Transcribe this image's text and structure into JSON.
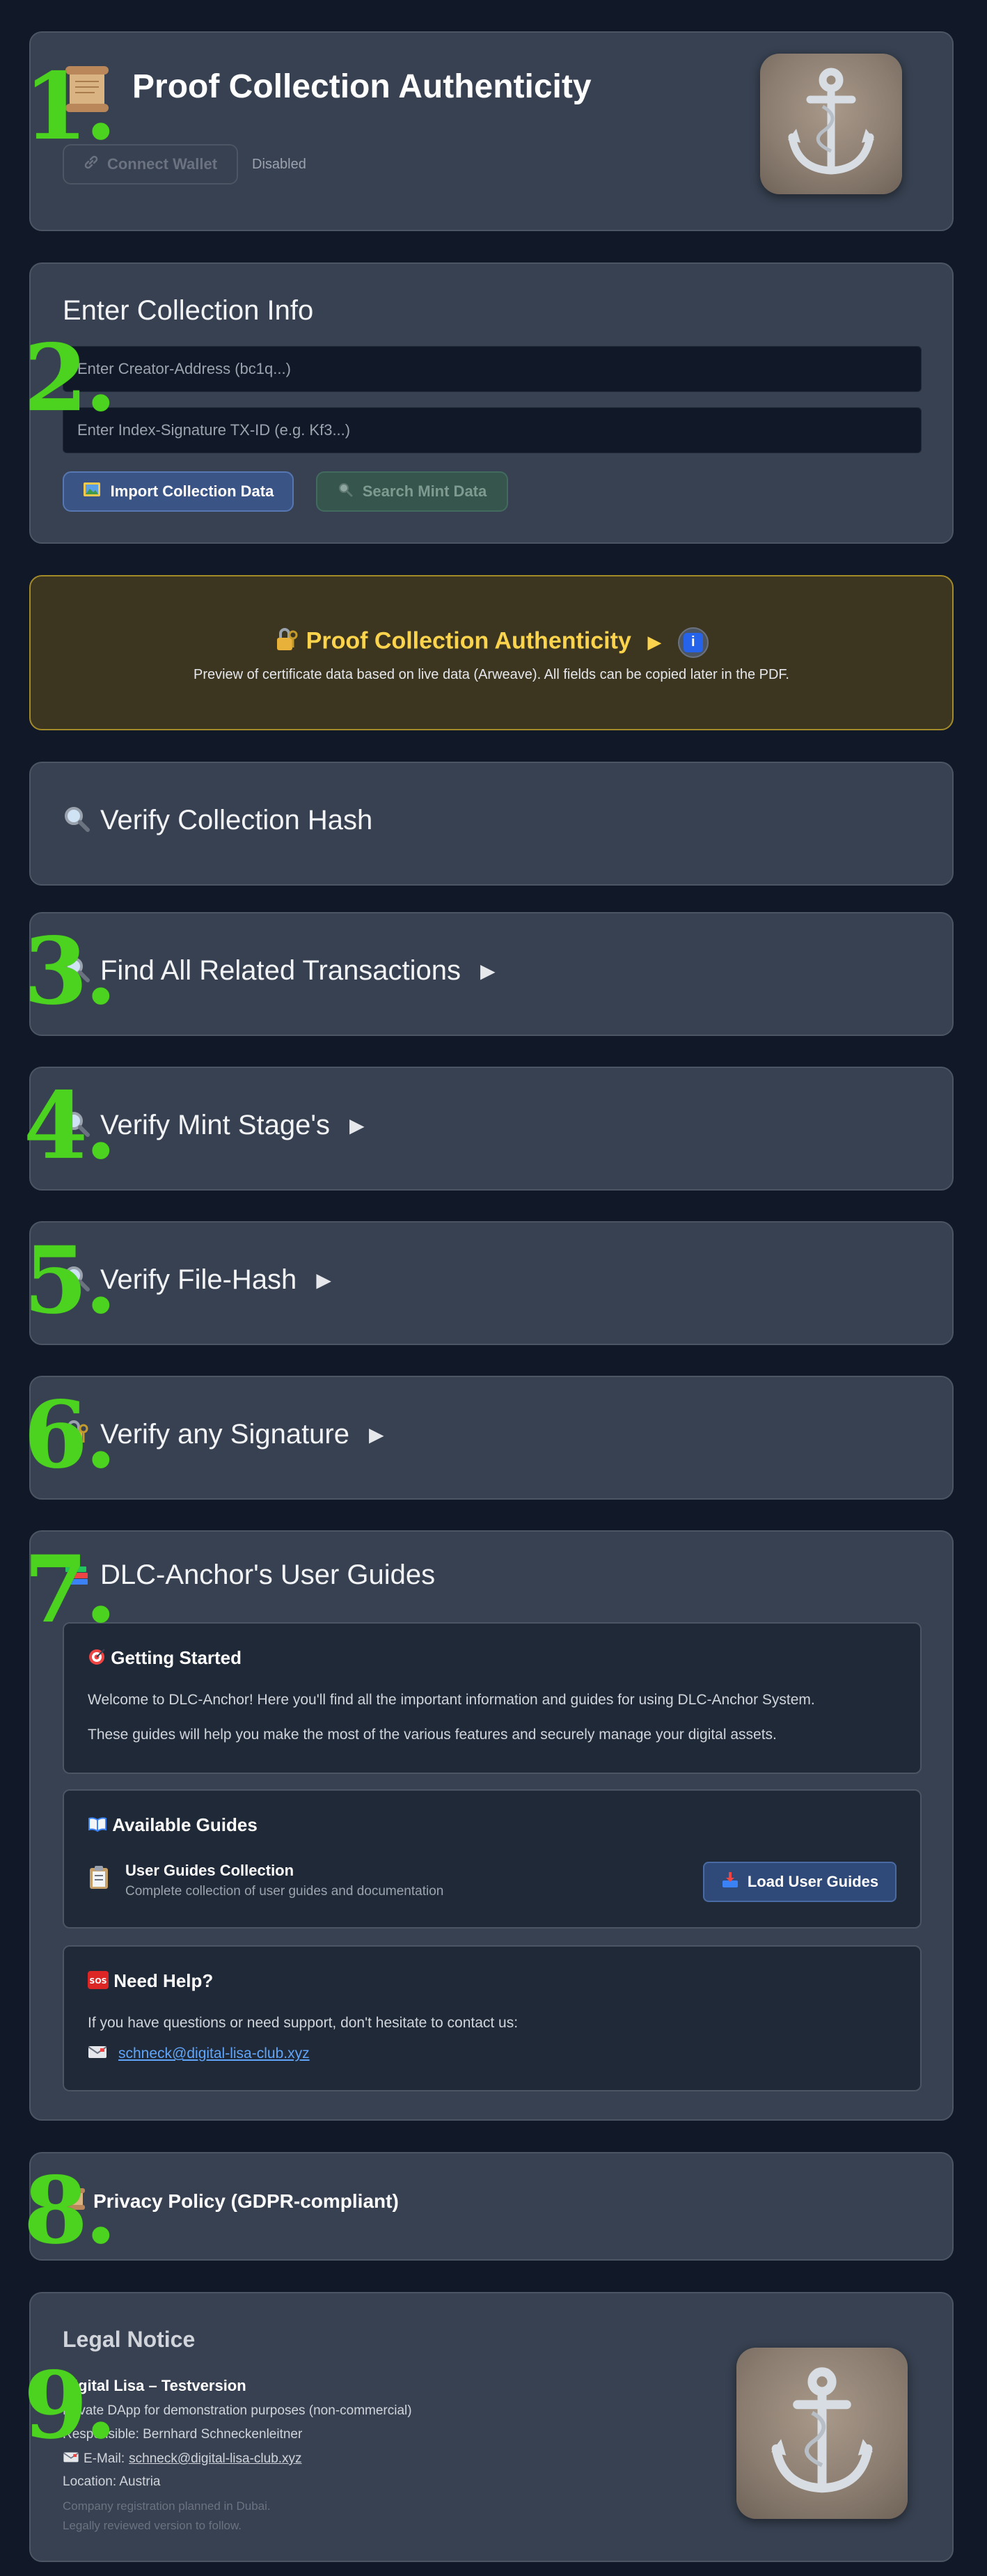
{
  "steps": [
    "1.",
    "2.",
    "3.",
    "4.",
    "5.",
    "6.",
    "7.",
    "8.",
    "9."
  ],
  "header": {
    "title": "Proof Collection Authenticity",
    "connect_wallet_label": "Connect Wallet",
    "disabled_label": "Disabled",
    "scroll_icon": "scroll-icon",
    "anchor_icon": "anchor-icon"
  },
  "collection_info": {
    "title": "Enter Collection Info",
    "creator_placeholder": "Enter Creator-Address (bc1q...)",
    "index_placeholder": "Enter Index-Signature TX-ID (e.g. Kf3...)",
    "import_label": "Import Collection Data",
    "search_label": "Search Mint Data"
  },
  "certificate": {
    "title": "Proof Collection Authenticity",
    "subtitle": "Preview of certificate data based on live data (Arweave). All fields can be copied later in the PDF.",
    "info_glyph": "i"
  },
  "sections": {
    "verify_hash": "Verify Collection Hash",
    "find_tx": "Find All Related Transactions",
    "verify_mint": "Verify Mint Stage's",
    "verify_file": "Verify File-Hash",
    "verify_sig": "Verify any Signature"
  },
  "guides": {
    "title": "DLC-Anchor's User Guides",
    "getting_started": {
      "title": "Getting Started",
      "text1": "Welcome to DLC-Anchor! Here you'll find all the important information and guides for using DLC-Anchor System.",
      "text2": "These guides will help you make the most of the various features and securely manage your digital assets."
    },
    "available": {
      "title": "Available Guides",
      "item_title": "User Guides Collection",
      "item_desc": "Complete collection of user guides and documentation",
      "load_label": "Load User Guides"
    },
    "help": {
      "title": "Need Help?",
      "text": "If you have questions or need support, don't hesitate to contact us:",
      "email": "schneck@digital-lisa-club.xyz"
    }
  },
  "privacy": {
    "title": "Privacy Policy (GDPR-compliant)"
  },
  "legal": {
    "title": "Legal Notice",
    "name": "Digital Lisa – Testversion",
    "line1": "Private DApp for demonstration purposes (non-commercial)",
    "line2": "Responsible: Bernhard Schneckenleitner",
    "email_prefix": "E-Mail: ",
    "email": "schneck@digital-lisa-club.xyz",
    "location": "Location: Austria",
    "note1": "Company registration planned in Dubai.",
    "note2": "Legally reviewed version to follow."
  },
  "colors": {
    "background": "#111827",
    "card": "#374151",
    "step_number": "#4cd31f",
    "accent_yellow": "#fcd34d",
    "link": "#60a5fa"
  }
}
